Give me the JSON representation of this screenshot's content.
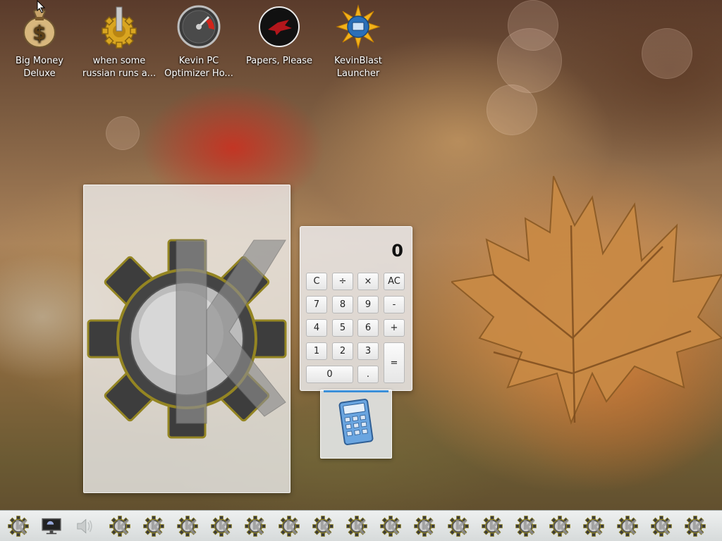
{
  "desktop": {
    "icons": [
      {
        "label": "Big Money Deluxe",
        "icon": "money-bag-icon"
      },
      {
        "label": "when some russian runs a...",
        "icon": "gear-icon"
      },
      {
        "label": "Kevin PC Optimizer Ho...",
        "icon": "gauge-icon"
      },
      {
        "label": "Papers, Please",
        "icon": "papers-please-icon"
      },
      {
        "label": "KevinBlast Launcher",
        "icon": "kevinblast-icon"
      }
    ]
  },
  "splash": {
    "logo": "kevin-gear-logo-icon"
  },
  "calculator": {
    "display": "0",
    "keys": {
      "clear": "C",
      "divide": "÷",
      "multiply": "×",
      "all_clear": "AC",
      "seven": "7",
      "eight": "8",
      "nine": "9",
      "minus": "-",
      "four": "4",
      "five": "5",
      "six": "6",
      "plus": "+",
      "one": "1",
      "two": "2",
      "three": "3",
      "equals": "=",
      "zero": "0",
      "decimal": "."
    }
  },
  "taskbar": {
    "items": [
      "kevin-gear-icon",
      "monitor-icon",
      "speaker-icon",
      "kevin-gear-icon",
      "kevin-gear-icon",
      "kevin-gear-icon",
      "kevin-gear-icon",
      "kevin-gear-icon",
      "kevin-gear-icon",
      "kevin-gear-icon",
      "kevin-gear-icon",
      "kevin-gear-icon",
      "kevin-gear-icon",
      "kevin-gear-icon",
      "kevin-gear-icon",
      "kevin-gear-icon",
      "kevin-gear-icon",
      "kevin-gear-icon",
      "kevin-gear-icon",
      "kevin-gear-icon",
      "kevin-gear-icon"
    ]
  },
  "colors": {
    "accent": "#3b8fd9",
    "taskbar": "#e2e5e5"
  }
}
